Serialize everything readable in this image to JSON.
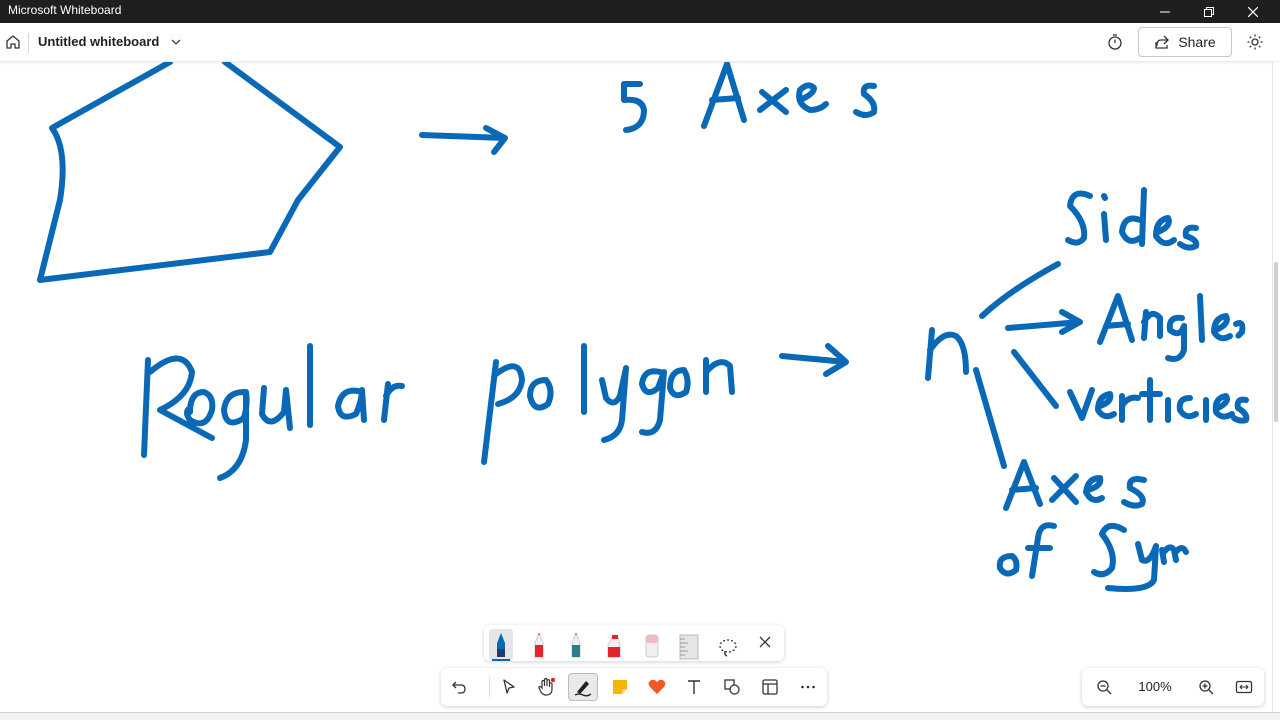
{
  "window": {
    "title": "Microsoft Whiteboard"
  },
  "header": {
    "board_title": "Untitled whiteboard",
    "share_label": "Share"
  },
  "canvas": {
    "ink_color": "#0a69b7",
    "handwriting": {
      "top_arrow_result": "5 Axes",
      "main_phrase": "Regular polygon",
      "variable": "n",
      "branches": [
        "Sides",
        "Angles",
        "vertices",
        "Axes of Sym."
      ]
    }
  },
  "pen_tray": {
    "items": [
      {
        "name": "blue-pen",
        "color": "#0a69b7"
      },
      {
        "name": "red-pen",
        "color": "#e3242b"
      },
      {
        "name": "teal-pen",
        "color": "#2f7d8c"
      },
      {
        "name": "red-highlighter",
        "color": "#e3242b"
      },
      {
        "name": "eraser",
        "color": "#f4b8c0"
      },
      {
        "name": "ruler",
        "color": "#d9d9d9"
      }
    ]
  },
  "toolbar": {
    "active_tool": "pen"
  },
  "zoom": {
    "level": "100%"
  }
}
